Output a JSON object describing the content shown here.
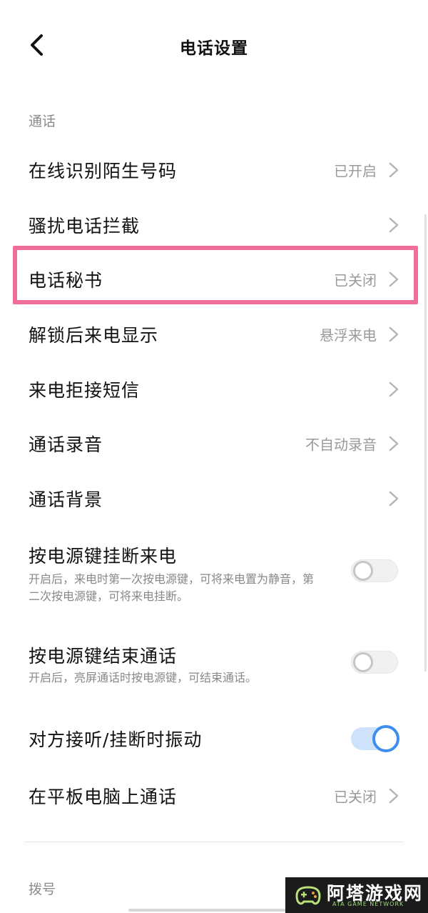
{
  "header": {
    "title": "电话设置",
    "back_icon": "chevron-left-icon"
  },
  "sections": {
    "calls": "通话",
    "dial": "拨号"
  },
  "rows": [
    {
      "label": "在线识别陌生号码",
      "value": "已开启"
    },
    {
      "label": "骚扰电话拦截",
      "value": ""
    },
    {
      "label": "电话秘书",
      "value": "已关闭"
    },
    {
      "label": "解锁后来电显示",
      "value": "悬浮来电"
    },
    {
      "label": "来电拒接短信",
      "value": ""
    },
    {
      "label": "通话录音",
      "value": "不自动录音"
    },
    {
      "label": "通话背景",
      "value": ""
    }
  ],
  "toggles": [
    {
      "title": "按电源键挂断来电",
      "description": "开启后，来电时第一次按电源键，可将来电置为静音，第二次按电源键，可将来电挂断。",
      "state": "off"
    },
    {
      "title": "按电源键结束通话",
      "description": "开启后，亮屏通话时按电源键，可结束通话。",
      "state": "off"
    },
    {
      "title": "对方接听/挂断时振动",
      "description": "",
      "state": "on"
    }
  ],
  "tablet_row": {
    "label": "在平板电脑上通话",
    "value": "已关闭"
  },
  "watermark": {
    "text": "阿塔游戏网",
    "subtext": "ATA GAME NETWORK"
  },
  "colors": {
    "highlight": "#f06e9a",
    "toggle_on": "#3e8ef0",
    "secondary_text": "#9a9a9a"
  }
}
